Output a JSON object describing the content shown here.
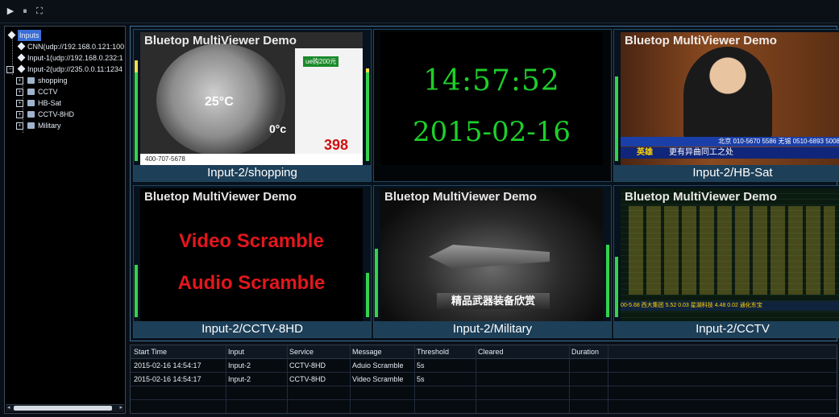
{
  "toolbar": {
    "play_icon": "▶",
    "pause_icon": "⏸",
    "fullscreen_icon": "⛶"
  },
  "tree": {
    "root": "Inputs",
    "items": [
      {
        "label": "CNN(udp://192.168.0.121:100"
      },
      {
        "label": "Input-1(udp://192.168.0.232:1"
      },
      {
        "label": "Input-2(udp://235.0.0.11:1234"
      }
    ],
    "children": [
      "shopping",
      "CCTV",
      "HB-Sat",
      "CCTV-8HD",
      "Military"
    ]
  },
  "tiles": [
    {
      "caption": "Input-2/shopping",
      "watermark": "Bluetop MultiViewer Demo",
      "inner": {
        "temp": "25°C",
        "temp2": "0°c",
        "price": "398",
        "phone": "400-707-5678",
        "badge": "ue购200元"
      }
    },
    {
      "caption": "",
      "time": "14:57:52",
      "date": "2015-02-16"
    },
    {
      "caption": "Input-2/HB-Sat",
      "watermark": "Bluetop MultiViewer Demo",
      "ticker1": "北京 010-5670 5586  无锡 0510-6893 5008",
      "ticker2": "更有异曲同工之处",
      "ticker_badge": "英雄"
    },
    {
      "caption": "Input-2/CCTV-8HD",
      "watermark": "Bluetop MultiViewer Demo",
      "line1": "Video Scramble",
      "line2": "Audio Scramble"
    },
    {
      "caption": "Input-2/Military",
      "watermark": "Bluetop MultiViewer Demo",
      "banner": "精品武器装备欣赏"
    },
    {
      "caption": "Input-2/CCTV",
      "watermark": "Bluetop MultiViewer Demo",
      "ticker": "00-5.68  西大集团 5.52 0.03  星湖科技 4.48 0.02  通化东宝"
    }
  ],
  "log": {
    "headers": [
      "Start Time",
      "Input",
      "Service",
      "Message",
      "Threshold",
      "Cleared",
      "Duration"
    ],
    "rows": [
      [
        "2015-02-16 14:54:17",
        "Input-2",
        "CCTV-8HD",
        "Aduio Scramble",
        "5s",
        "",
        ""
      ],
      [
        "2015-02-16 14:54:17",
        "Input-2",
        "CCTV-8HD",
        "Video Scramble",
        "5s",
        "",
        ""
      ]
    ]
  },
  "colors": {
    "clock": "#1ecf2a",
    "scramble": "#e3171d",
    "caption_bg": "#1d3f58",
    "selection": "#3a6fd8"
  }
}
